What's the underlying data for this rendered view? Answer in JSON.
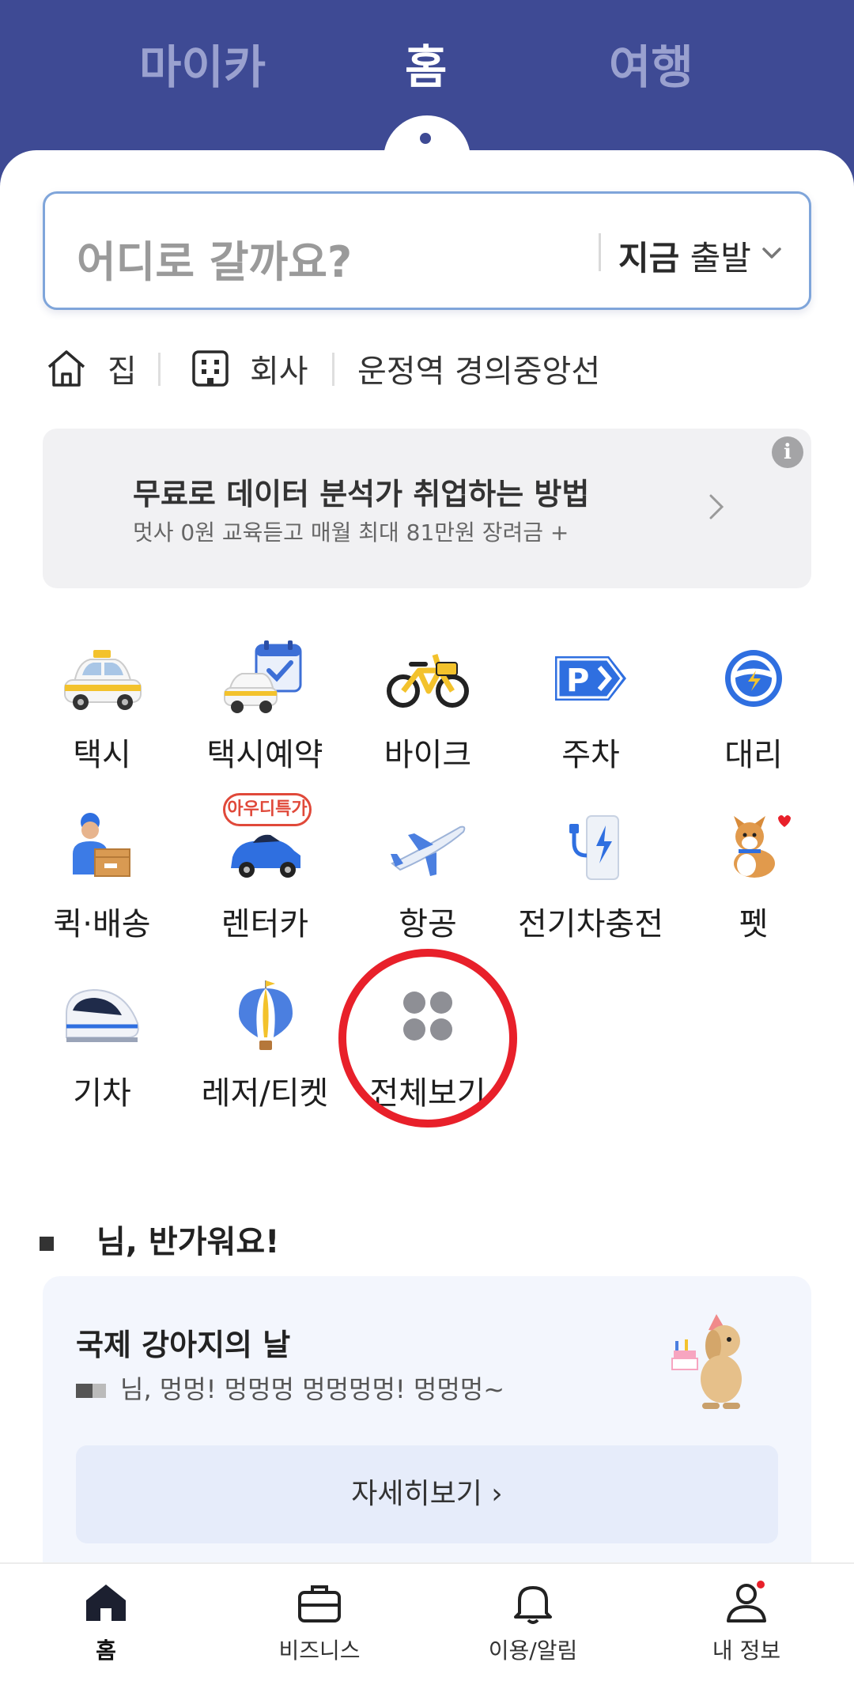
{
  "top_tabs": [
    {
      "label": "마이카"
    },
    {
      "label": "홈"
    },
    {
      "label": "여행"
    }
  ],
  "search": {
    "placeholder": "어디로 갈까요?",
    "depart_time": "지금",
    "depart_label": "출발"
  },
  "quick_places": [
    {
      "label": "집",
      "icon": "home-icon"
    },
    {
      "label": "회사",
      "icon": "building-icon"
    },
    {
      "label": "운정역 경의중앙선"
    }
  ],
  "ad": {
    "title": "무료로 데이터 분석가 취업하는 방법",
    "subtitle": "멋사 0원 교육듣고 매월 최대 81만원 장려금 +",
    "info": "i"
  },
  "services": [
    {
      "label": "택시",
      "icon": "taxi-icon"
    },
    {
      "label": "택시예약",
      "icon": "taxi-reservation-icon"
    },
    {
      "label": "바이크",
      "icon": "bike-icon"
    },
    {
      "label": "주차",
      "icon": "parking-icon"
    },
    {
      "label": "대리",
      "icon": "steering-wheel-icon"
    },
    {
      "label": "퀵·배송",
      "icon": "delivery-icon"
    },
    {
      "label": "렌터카",
      "icon": "rental-car-icon",
      "badge": "아우디특가"
    },
    {
      "label": "항공",
      "icon": "airplane-icon"
    },
    {
      "label": "전기차충전",
      "icon": "ev-charger-icon"
    },
    {
      "label": "펫",
      "icon": "pet-icon"
    },
    {
      "label": "기차",
      "icon": "train-icon"
    },
    {
      "label": "레저/티켓",
      "icon": "balloon-icon"
    },
    {
      "label": "전체보기",
      "icon": "grid-icon"
    }
  ],
  "greeting": {
    "text": "님, 반가워요!"
  },
  "promo": {
    "title": "국제 강아지의 날",
    "subtitle": "님, 멍멍! 멍멍멍 멍멍멍멍! 멍멍멍~",
    "button": "자세히보기 ›"
  },
  "bottom_nav": [
    {
      "label": "홈",
      "icon": "home-icon"
    },
    {
      "label": "비즈니스",
      "icon": "briefcase-icon"
    },
    {
      "label": "이용/알림",
      "icon": "bell-icon"
    },
    {
      "label": "내 정보",
      "icon": "person-icon"
    }
  ],
  "colors": {
    "header_bg": "#3e4a94",
    "accent_red": "#e8202a",
    "search_border": "#7fa5da"
  }
}
